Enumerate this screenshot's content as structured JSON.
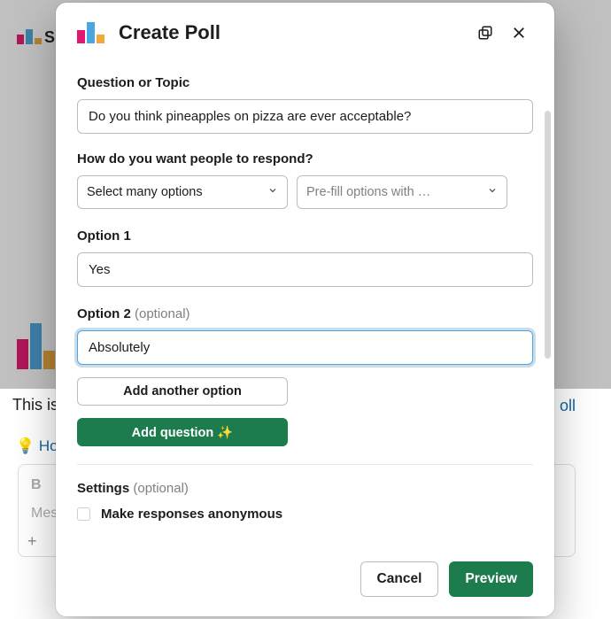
{
  "background": {
    "app_initial": "Si",
    "bottom_text_left": "This is",
    "bottom_text_right": "oll",
    "hint_text": "Ho",
    "compose_bold": "B",
    "compose_placeholder": "Mess",
    "compose_plus": "+"
  },
  "modal": {
    "title": "Create Poll",
    "question_label": "Question or Topic",
    "question_value": "Do you think pineapples on pizza are ever acceptable?",
    "respond_label": "How do you want people to respond?",
    "select_mode": "Select many options",
    "prefill_label": "Pre-fill options with …",
    "option1_label": "Option 1",
    "option1_value": "Yes",
    "option2_label": "Option 2",
    "option2_optional": "(optional)",
    "option2_value": "Absolutely",
    "add_another": "Add another option",
    "add_question": "Add question ✨",
    "settings_label": "Settings",
    "settings_optional": "(optional)",
    "anonymous_label": "Make responses anonymous"
  },
  "footer": {
    "cancel": "Cancel",
    "preview": "Preview"
  },
  "colors": {
    "accent": "#1d7c4d",
    "focus": "#1264a3"
  }
}
